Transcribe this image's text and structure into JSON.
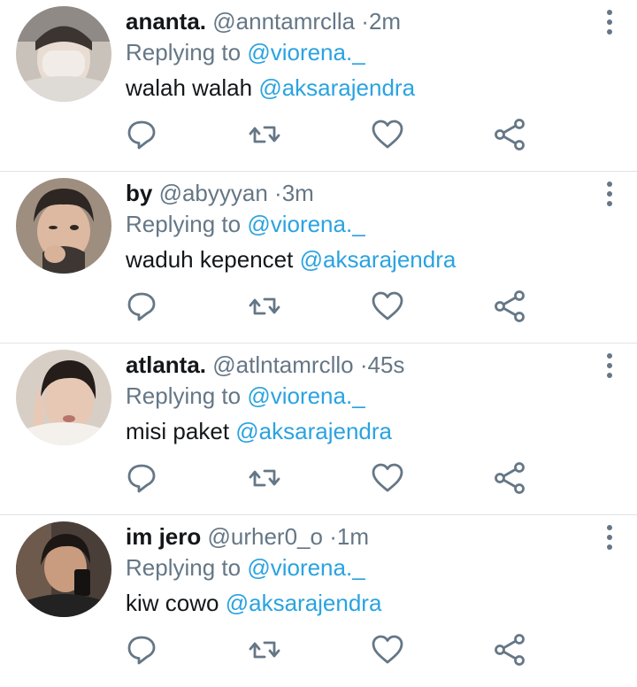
{
  "tweets": [
    {
      "name": "ananta.",
      "handle": "@anntamrclla",
      "time": "2m",
      "reply_prefix": "Replying to",
      "reply_to": "@viorena._",
      "text": "walah walah",
      "mention": "@aksarajendra"
    },
    {
      "name": "by",
      "handle": "@abyyyan",
      "time": "3m",
      "reply_prefix": "Replying to",
      "reply_to": "@viorena._",
      "text": "waduh kepencet",
      "mention": "@aksarajendra"
    },
    {
      "name": "atlanta.",
      "handle": "@atlntamrcllo",
      "time": "45s",
      "reply_prefix": "Replying to",
      "reply_to": "@viorena._",
      "text": "misi paket",
      "mention": "@aksarajendra"
    },
    {
      "name": "im jero",
      "handle": "@urher0_o",
      "time": "1m",
      "reply_prefix": "Replying to",
      "reply_to": "@viorena._",
      "text": "kiw cowo",
      "mention": "@aksarajendra"
    }
  ],
  "separator": "·",
  "icons": {
    "reply": "reply-icon",
    "retweet": "retweet-icon",
    "like": "heart-icon",
    "share": "share-icon",
    "more": "more-vertical-icon"
  },
  "colors": {
    "link": "#2aa3e0",
    "secondary_text": "#657786",
    "icon": "#657786",
    "divider": "#dfe3e6"
  }
}
